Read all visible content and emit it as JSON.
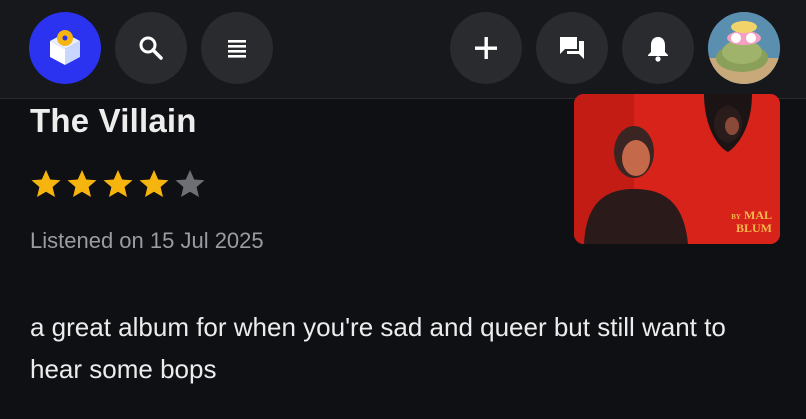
{
  "topbar": {
    "icons": {
      "logo": "record-box-logo-icon",
      "search": "search-icon",
      "menu": "menu-list-icon",
      "add": "plus-icon",
      "chat": "chat-icon",
      "notifications": "bell-icon",
      "avatar": "user-avatar"
    },
    "colors": {
      "logo_bg": "#2b33f0",
      "button_bg": "#2a2b2f",
      "bar_bg": "#17181c"
    }
  },
  "review": {
    "album_title": "The Villain",
    "rating": 4,
    "rating_max": 5,
    "listened": "Listened on 15 Jul 2025",
    "text": "a great album for when you're sad and queer but still want to hear some bops",
    "cover": {
      "artist_prefix": "BY",
      "artist_line1": "MAL",
      "artist_line2": "BLUM",
      "background": "#d8231b"
    }
  },
  "colors": {
    "star_filled": "#f6b40e",
    "star_empty": "#6e6f74",
    "page_bg": "#0f1014"
  }
}
